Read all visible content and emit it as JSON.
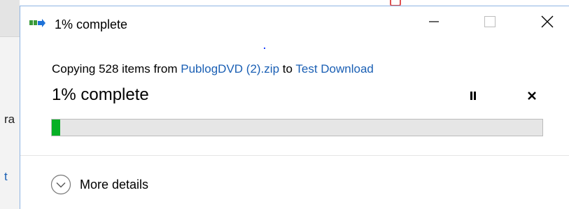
{
  "background": {
    "fragment_a": "ra",
    "fragment_b": "t"
  },
  "window": {
    "title": "1% complete",
    "icon": "copy-files-icon",
    "controls": {
      "minimize": "minimize-icon",
      "maximize": "maximize-icon",
      "close": "close-icon"
    }
  },
  "copy": {
    "prefix": "Copying 528 items from ",
    "source": "PublogDVD (2).zip",
    "middle": " to ",
    "destination": "Test Download"
  },
  "progress": {
    "title": "1% complete",
    "percent": 1,
    "fill_color": "#06b025",
    "pause_icon": "pause-icon",
    "cancel_icon": "cancel-icon"
  },
  "details": {
    "label": "More details",
    "icon": "chevron-down-icon"
  },
  "colors": {
    "link": "#1a5fb4",
    "window_border": "#8eb4e3",
    "progress_track": "#e6e6e6"
  }
}
